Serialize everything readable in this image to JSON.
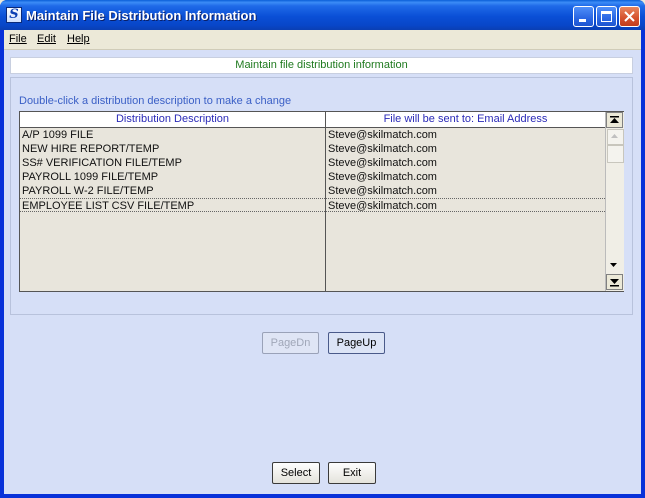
{
  "window": {
    "title": "Maintain File Distribution Information",
    "icon_letter": "S"
  },
  "menu": [
    {
      "label": "File"
    },
    {
      "label": "Edit"
    },
    {
      "label": "Help"
    }
  ],
  "header": {
    "text": "Maintain file distribution information"
  },
  "instruction": "Double-click a distribution description to make a change",
  "table": {
    "columns": [
      "Distribution Description",
      "File will be sent to: Email Address"
    ],
    "rows": [
      {
        "description": "A/P 1099 FILE",
        "email": "Steve@skilmatch.com"
      },
      {
        "description": "NEW HIRE REPORT/TEMP",
        "email": "Steve@skilmatch.com"
      },
      {
        "description": "SS# VERIFICATION FILE/TEMP",
        "email": "Steve@skilmatch.com"
      },
      {
        "description": "PAYROLL 1099 FILE/TEMP",
        "email": "Steve@skilmatch.com"
      },
      {
        "description": "PAYROLL W-2 FILE/TEMP",
        "email": "Steve@skilmatch.com"
      },
      {
        "description": "EMPLOYEE LIST CSV FILE/TEMP",
        "email": "Steve@skilmatch.com"
      }
    ],
    "selected_row": 5
  },
  "buttons": {
    "page_dn": "PageDn",
    "page_up": "PageUp",
    "select": "Select",
    "exit": "Exit"
  },
  "colors": {
    "title_bar": "#0a4fd6",
    "panel_bg": "#d6dff7",
    "header_text": "#1f7a1f",
    "instruction_text": "#3a5fc6"
  }
}
